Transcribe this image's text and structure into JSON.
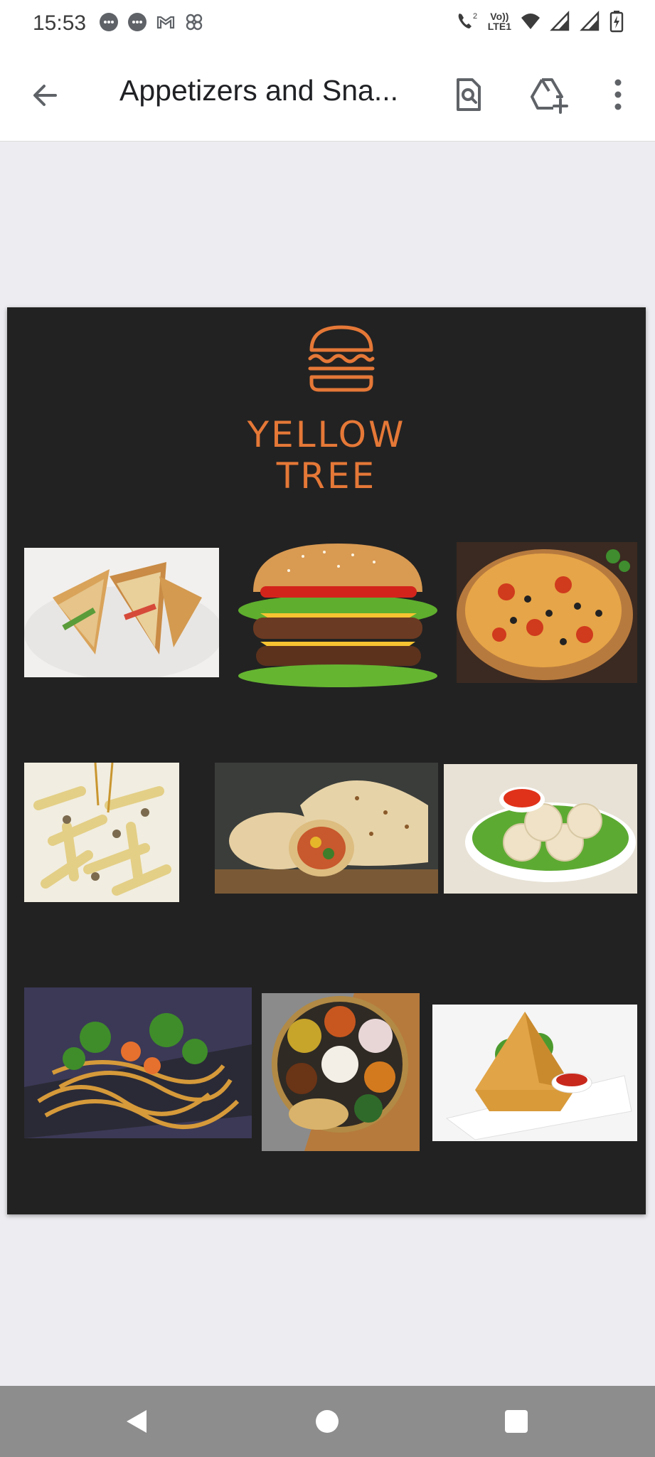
{
  "status_bar": {
    "time": "15:53",
    "left_icons": [
      "message-icon",
      "chat-icon",
      "gmail-icon",
      "pinwheel-icon"
    ],
    "right_icons": [
      "wifi-call-icon",
      "volte-icon",
      "wifi-icon",
      "signal-icon",
      "signal-icon",
      "battery-charging-icon"
    ],
    "volte_line1": "Vo))",
    "volte_line2": "LTE1",
    "call_sup": "2"
  },
  "toolbar": {
    "back_icon": "arrow-left-icon",
    "title": "Appetizers and Sna...",
    "find_icon": "find-in-page-icon",
    "add_to_drive_icon": "add-to-drive-icon",
    "more_icon": "more-vert-icon"
  },
  "document": {
    "logo_icon": "burger-icon",
    "brand_line1": "YELLOW",
    "brand_line2": "TREE",
    "accent_color": "#e57837",
    "background_color": "#222222",
    "photos": [
      "club-sandwich",
      "cheeseburger",
      "pizza",
      "penne-pasta",
      "wrap-roll",
      "momos",
      "hakka-noodles",
      "thali",
      "samosa"
    ]
  },
  "nav_bar": {
    "back": "nav-back-icon",
    "home": "nav-home-icon",
    "recents": "nav-recents-icon"
  }
}
